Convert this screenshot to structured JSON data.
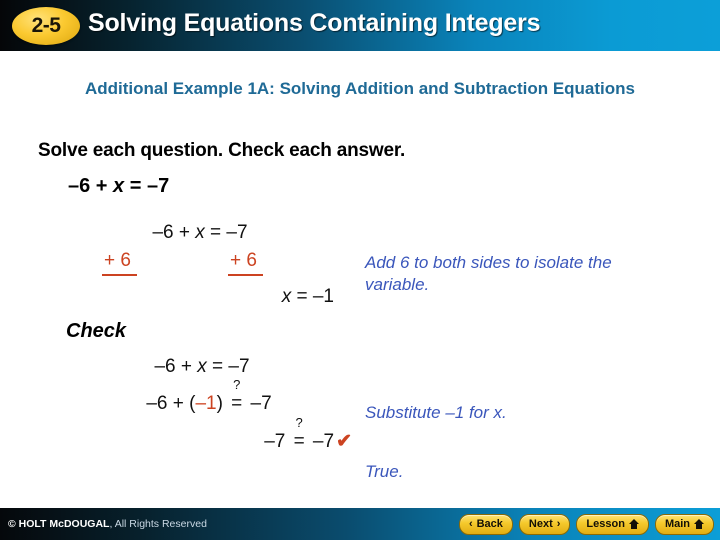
{
  "header": {
    "badge": "2-5",
    "title": "Solving Equations Containing Integers"
  },
  "subtitle": "Additional Example 1A: Solving Addition and Subtraction Equations",
  "instruction": "Solve each question. Check each answer.",
  "problem": {
    "left": "–6 + ",
    "var": "x",
    "right": " = –7"
  },
  "work": {
    "eq_line": {
      "pre": "–6 + ",
      "var": "x",
      "post": " = –7"
    },
    "add_left": "+ 6",
    "add_right": "+ 6",
    "solution": {
      "var": "x",
      "rest": " = –1"
    }
  },
  "check_label": "Check",
  "check_work": {
    "line1": {
      "pre": "–6 + ",
      "var": "x",
      "post": " = –7"
    },
    "line2": {
      "pre": "–6 + (",
      "sub": "–1",
      "mid": ") ",
      "qmark": "?",
      "eq": "=",
      "post": " –7"
    },
    "line3": {
      "pre": "–7 ",
      "qmark": "?",
      "eq": "=",
      "post": " –7",
      "check": "✔"
    }
  },
  "annotations": {
    "step1": "Add 6 to both sides to isolate the variable.",
    "step2": "Substitute –1 for x.",
    "step3": "True."
  },
  "footer": {
    "copyright_bold": "© HOLT McDOUGAL",
    "copyright_rest": ", All Rights Reserved",
    "buttons": [
      {
        "label": "Back",
        "icon": "chevron-left",
        "glyph": "‹"
      },
      {
        "label": "Next",
        "icon": "chevron-right",
        "glyph": "›"
      },
      {
        "label": "Lesson",
        "icon": "home"
      },
      {
        "label": "Main",
        "icon": "home"
      }
    ]
  },
  "colors": {
    "accent_orange": "#cc4321",
    "annotation_blue": "#3a56bb",
    "subtitle_blue": "#1f6a96",
    "badge_yellow": "#f5c92c"
  }
}
